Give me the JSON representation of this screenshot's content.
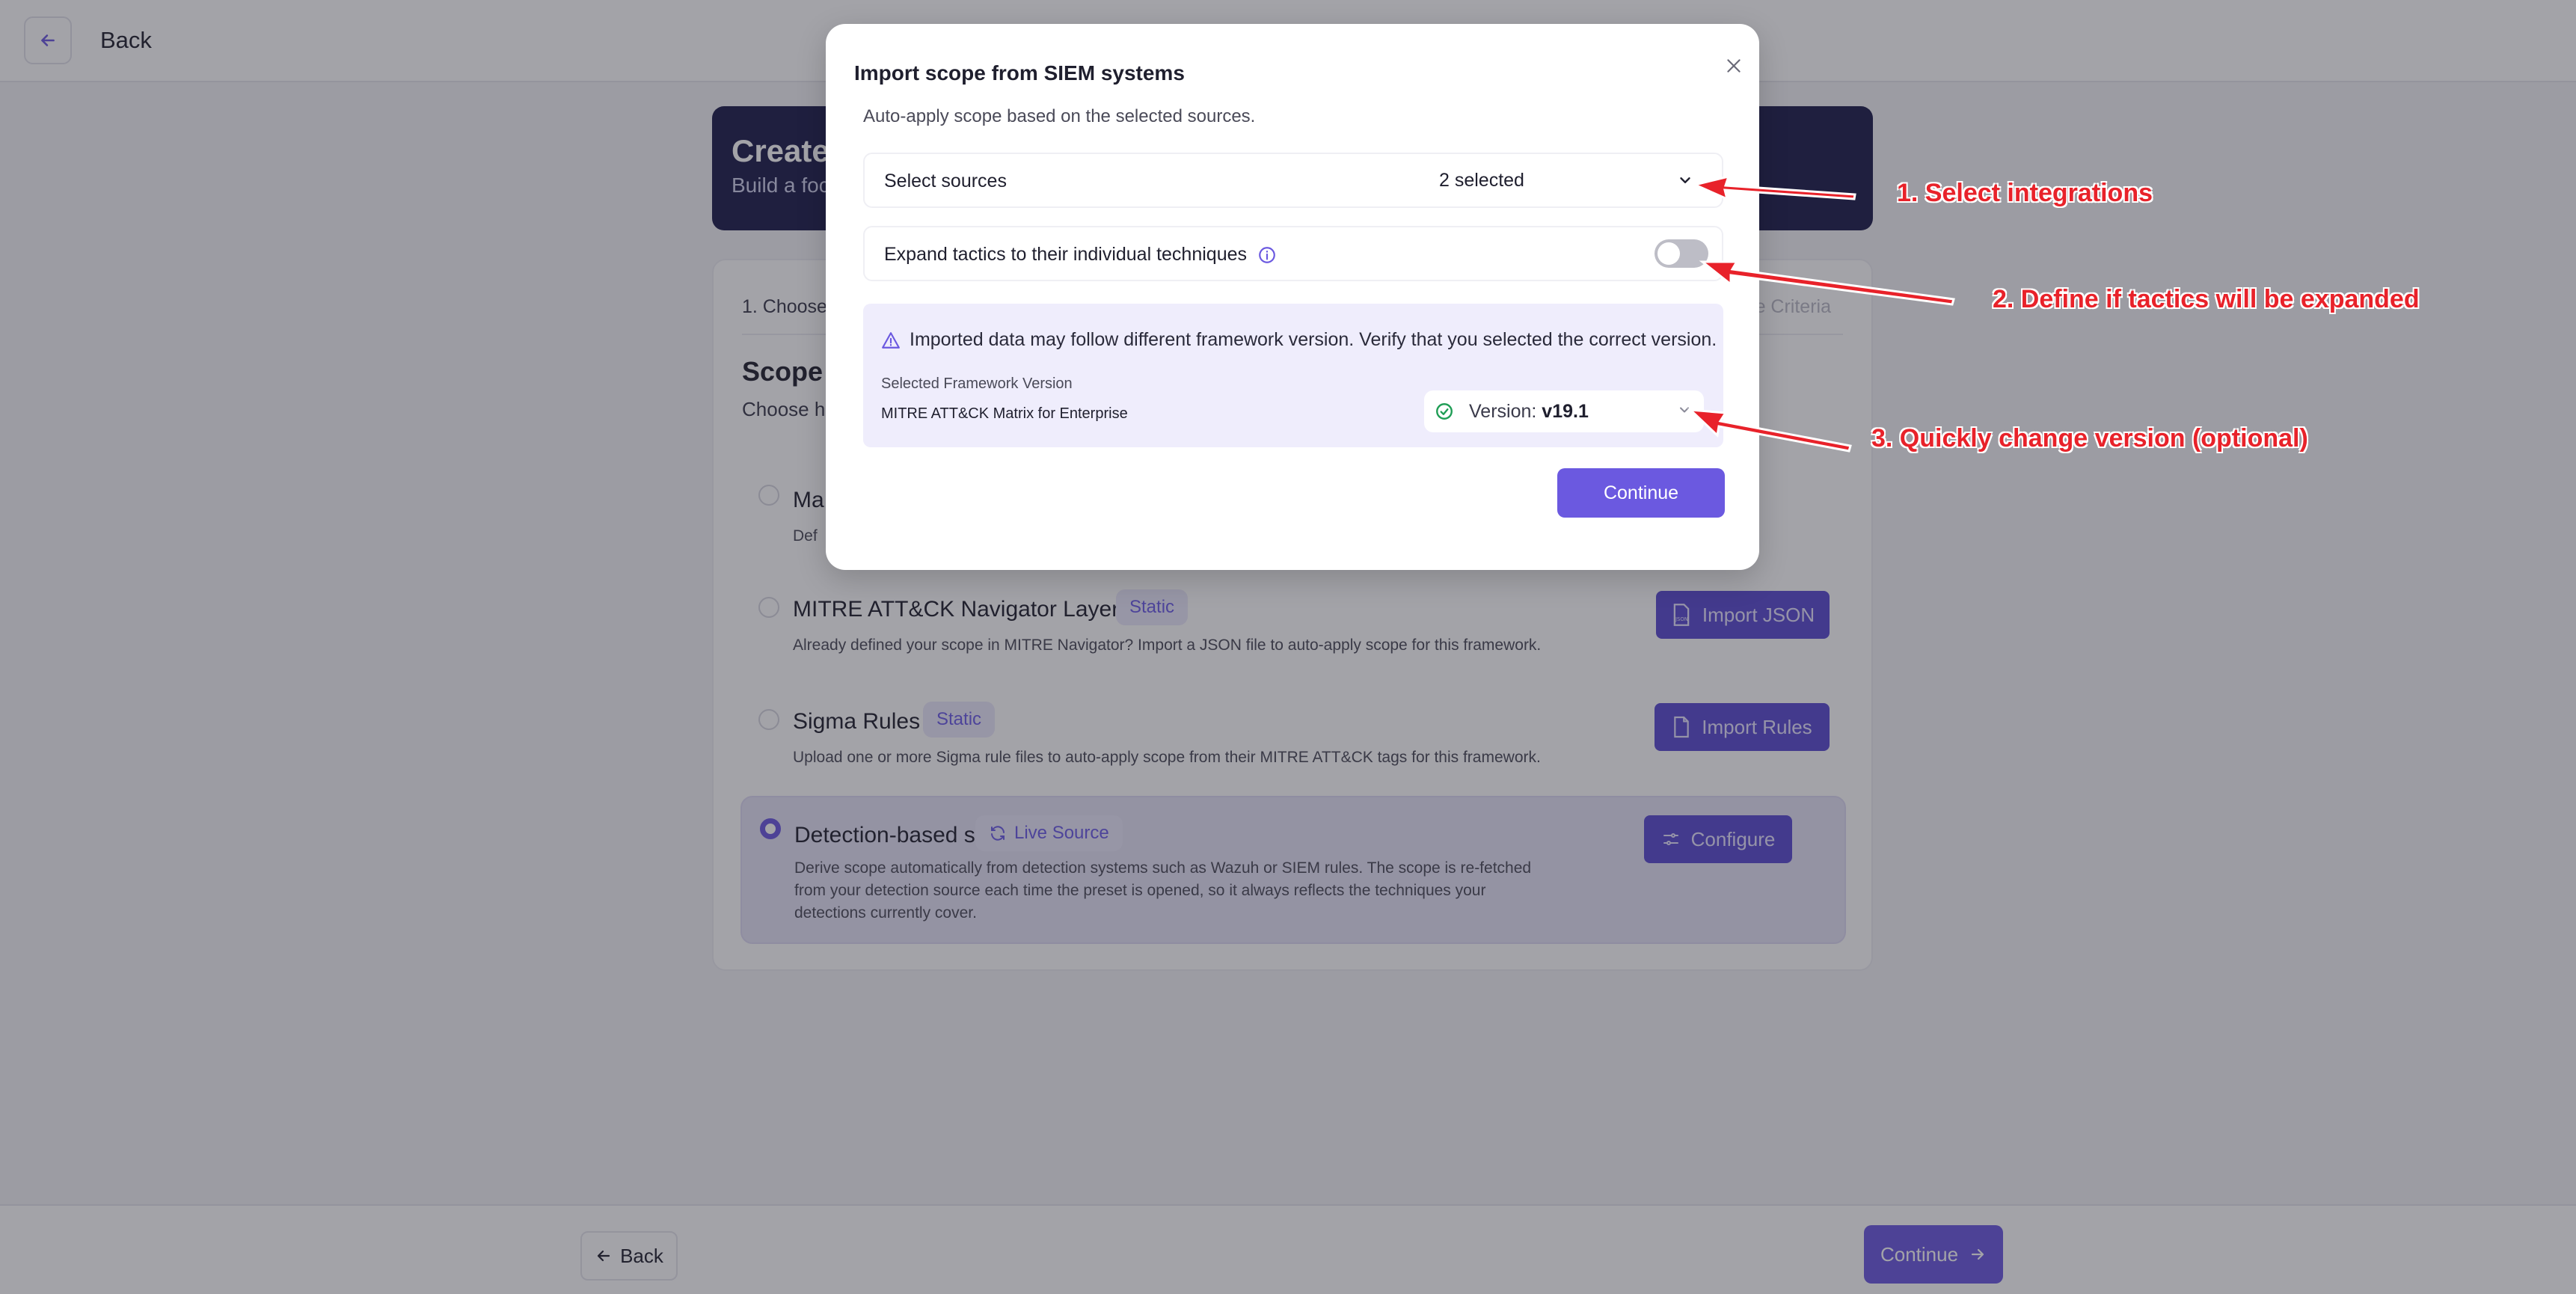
{
  "topbar": {
    "back_label": "Back"
  },
  "hero": {
    "title": "Create",
    "subtitle": "Build a foc"
  },
  "steps": {
    "current": "1. Choose F",
    "right": "e Criteria"
  },
  "scope": {
    "title": "Scope S",
    "subtitle": "Choose ho"
  },
  "options": {
    "manual": {
      "title": "Ma",
      "desc": "Def"
    },
    "navigator": {
      "title": "MITRE ATT&CK Navigator Layer",
      "tag": "Static",
      "desc": "Already defined your scope in MITRE Navigator? Import a JSON file to auto-apply scope for this framework.",
      "button": "Import JSON"
    },
    "sigma": {
      "title": "Sigma Rules",
      "tag": "Static",
      "desc": "Upload one or more Sigma rule files to auto-apply scope from their MITRE ATT&CK tags for this framework.",
      "button": "Import Rules"
    },
    "detection": {
      "title": "Detection-based scope",
      "tag": "Live Source",
      "desc": "Derive scope automatically from detection systems such as Wazuh or SIEM rules. The scope is re-fetched from your detection source each time the preset is opened, so it always reflects the techniques your detections currently cover.",
      "button": "Configure"
    }
  },
  "footer": {
    "back_label": "Back",
    "continue_label": "Continue"
  },
  "modal": {
    "title": "Import scope from SIEM systems",
    "subtitle": "Auto-apply scope based on the selected sources.",
    "sources_label": "Select sources",
    "sources_value": "2 selected",
    "expand_label": "Expand tactics to their individual techniques",
    "expand_enabled": false,
    "warning": "Imported data may follow different framework version. Verify that you selected the correct version.",
    "framework_label": "Selected Framework Version",
    "framework_name": "MITRE ATT&CK Matrix for Enterprise",
    "version_prefix": "Version:",
    "version_value": "v19.1",
    "continue_label": "Continue"
  },
  "annotations": {
    "a1": "1. Select integrations",
    "a2": "2. Define if tactics will be expanded",
    "a3": "3. Quickly change version (optional)"
  },
  "colors": {
    "accent": "#6b59e0",
    "hero_bg": "#1d1d4a",
    "annotation": "#e8222a",
    "tag_bg": "#ebe8fb"
  }
}
